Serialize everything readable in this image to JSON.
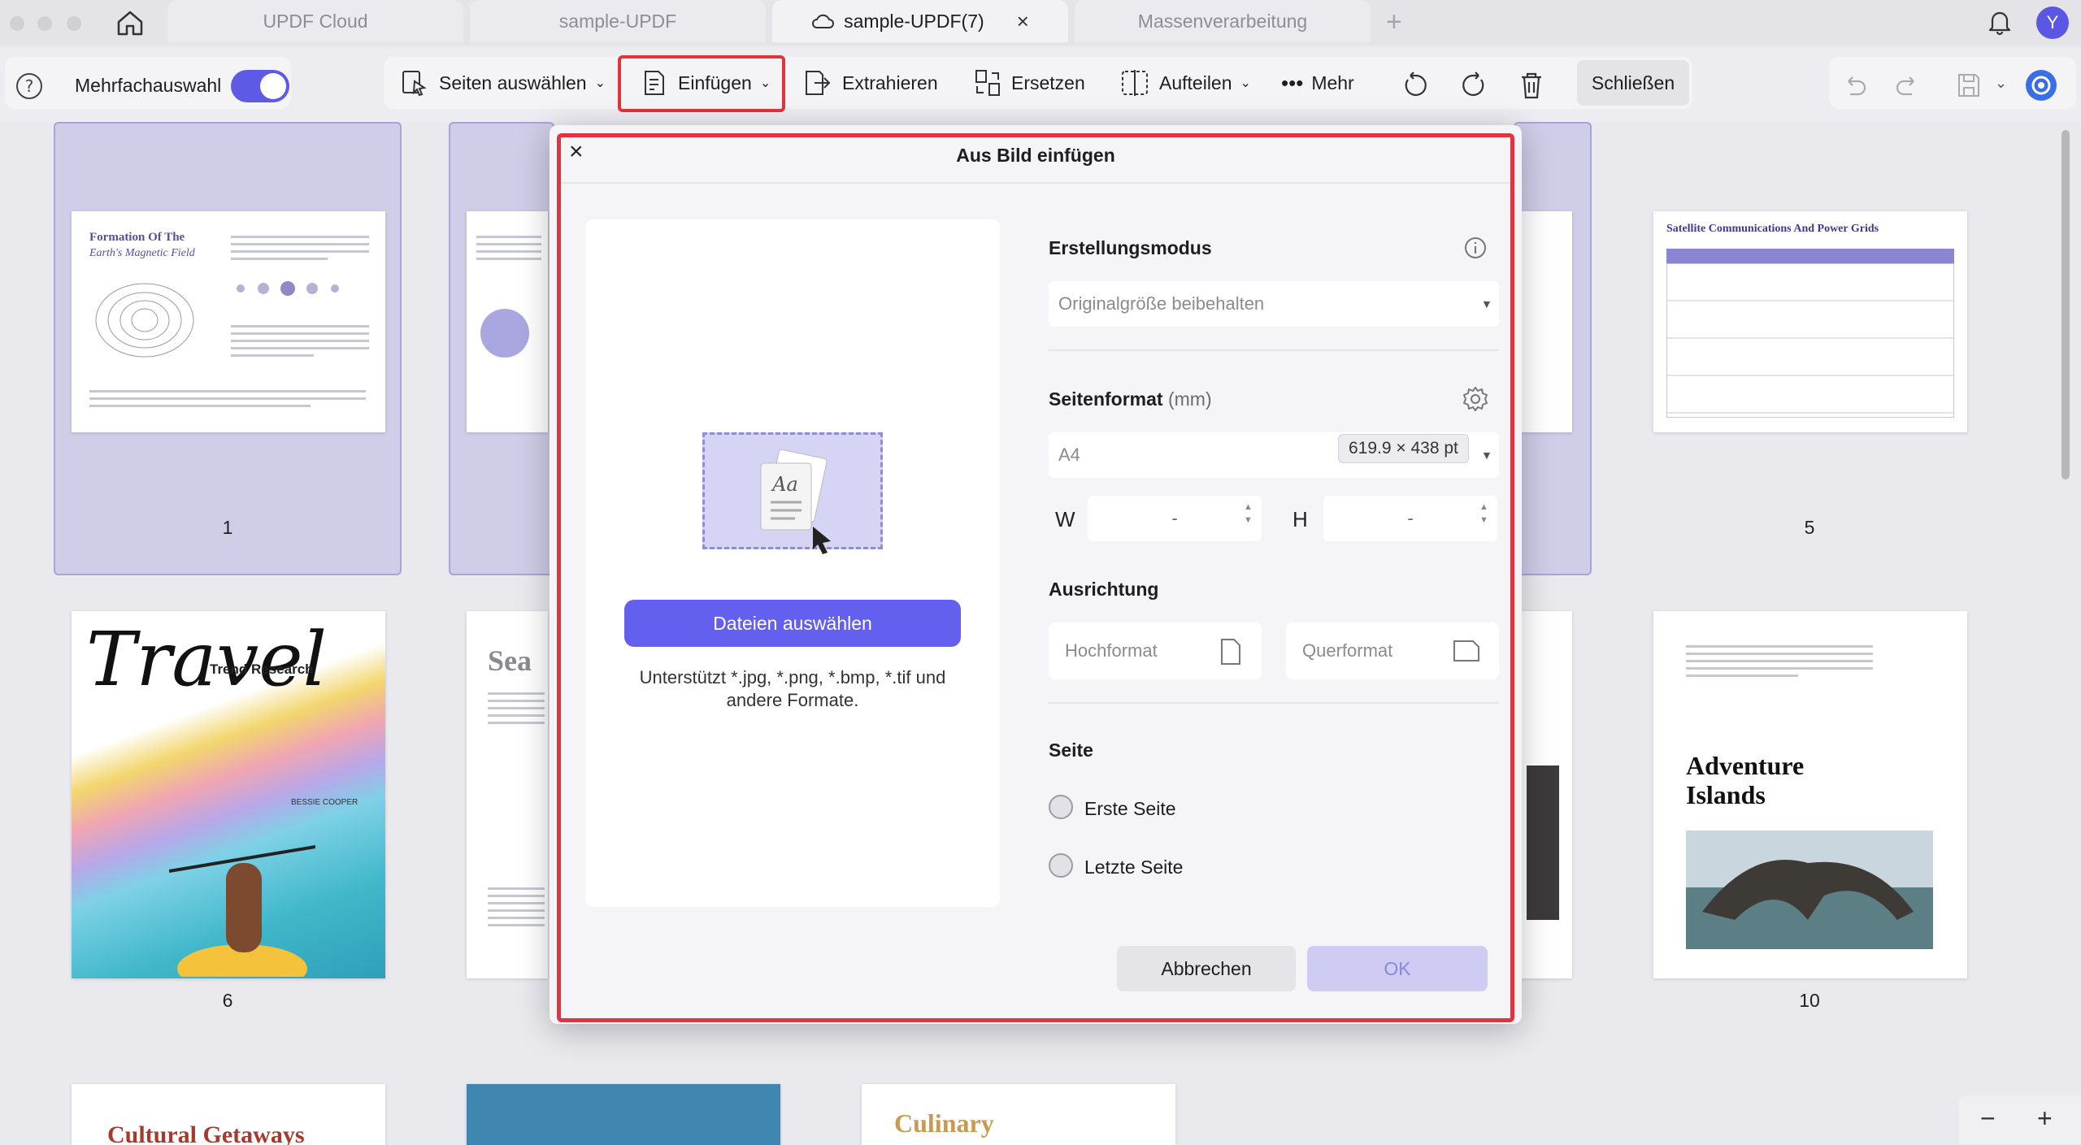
{
  "tabs": [
    {
      "label": "UPDF Cloud"
    },
    {
      "label": "sample-UPDF"
    },
    {
      "label": "sample-UPDF(7)"
    },
    {
      "label": "Massenverarbeitung"
    }
  ],
  "user": {
    "initial": "Y"
  },
  "toolbar": {
    "multi_select_label": "Mehrfachauswahl",
    "select_pages_label": "Seiten auswählen",
    "insert_label": "Einfügen",
    "extract_label": "Extrahieren",
    "replace_label": "Ersetzen",
    "split_label": "Aufteilen",
    "more_label": "Mehr",
    "close_label": "Schließen"
  },
  "pages": {
    "p1_title_a": "Formation Of The",
    "p1_title_b": "Earth's Magnetic Field",
    "p5_title": "Satellite Communications And Power Grids",
    "p6_title": "Travel",
    "p6_sub": "Trend Research",
    "p6_author": "BESSIE COOPER",
    "p10_title_a": "Adventure",
    "p10_title_b": "Islands",
    "p2_partial": "Sea",
    "bottom1": "Cultural Getaways",
    "bottom3": "Culinary",
    "num1": "1",
    "num5": "5",
    "num6": "6",
    "num10": "10"
  },
  "dialog": {
    "title": "Aus Bild einfügen",
    "choose_files": "Dateien auswählen",
    "support_text_1": "Unterstützt *.jpg, *.png, *.bmp, *.tif und",
    "support_text_2": "andere Formate.",
    "creation_mode_label": "Erstellungsmodus",
    "creation_mode_value": "Originalgröße beibehalten",
    "page_format_label": "Seitenformat",
    "page_format_unit": "(mm)",
    "page_format_value": "A4",
    "page_format_badge": "619.9 × 438 pt",
    "w_label": "W",
    "h_label": "H",
    "w_value": "-",
    "h_value": "-",
    "orientation_label": "Ausrichtung",
    "portrait": "Hochformat",
    "landscape": "Querformat",
    "page_label": "Seite",
    "first_page": "Erste Seite",
    "last_page": "Letzte Seite",
    "cancel": "Abbrechen",
    "ok": "OK"
  },
  "zoom": {
    "minus": "−",
    "plus": "+"
  },
  "colors": {
    "accent": "#6460ef",
    "highlight": "#e0343e"
  }
}
